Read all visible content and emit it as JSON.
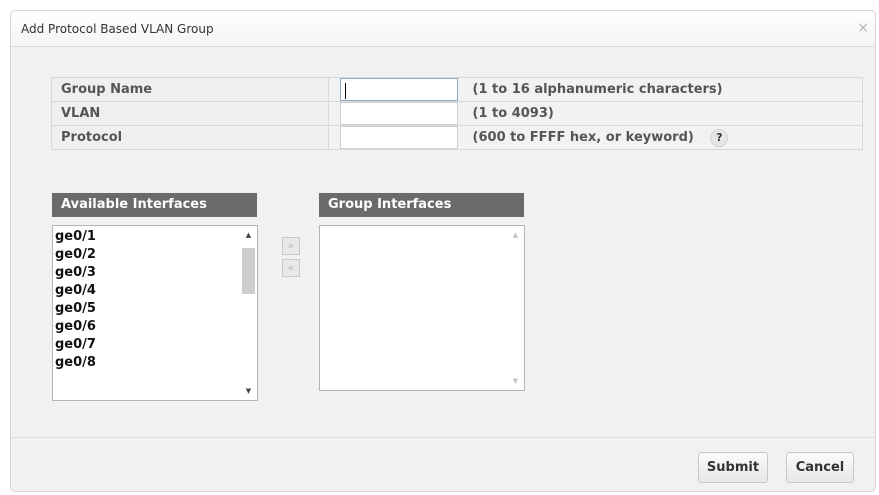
{
  "dialog": {
    "title": "Add Protocol Based VLAN Group",
    "close_symbol": "×"
  },
  "form": {
    "rows": [
      {
        "label": "Group Name",
        "value": "",
        "hint": "(1 to 16 alphanumeric characters)"
      },
      {
        "label": "VLAN",
        "value": "",
        "hint": "(1 to 4093)"
      },
      {
        "label": "Protocol",
        "value": "",
        "hint": "(600 to FFFF hex, or keyword)"
      }
    ],
    "help_symbol": "?"
  },
  "available": {
    "header": "Available Interfaces",
    "items": [
      "ge0/1",
      "ge0/2",
      "ge0/3",
      "ge0/4",
      "ge0/5",
      "ge0/6",
      "ge0/7",
      "ge0/8"
    ]
  },
  "group": {
    "header": "Group Interfaces",
    "items": []
  },
  "move": {
    "add_symbol": "»",
    "remove_symbol": "«"
  },
  "buttons": {
    "submit": "Submit",
    "cancel": "Cancel"
  }
}
